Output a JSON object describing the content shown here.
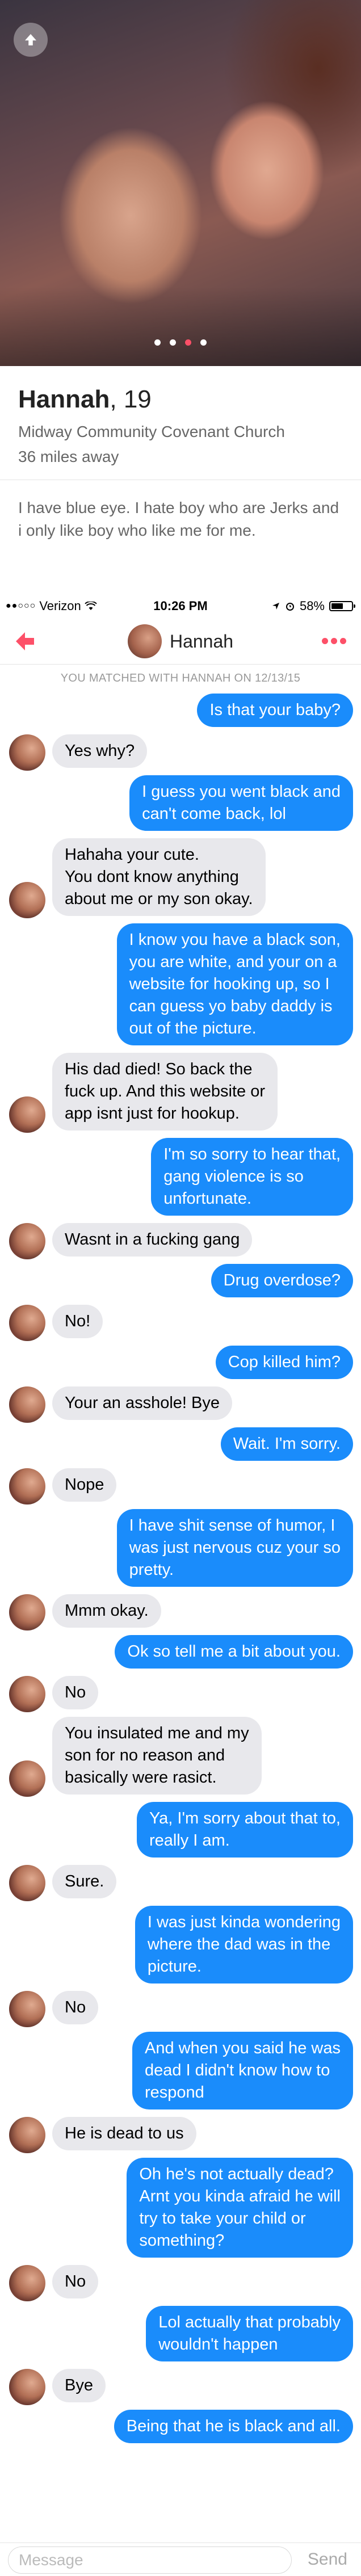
{
  "colors": {
    "accent": "#fd5068",
    "outgoing_bubble": "#1a8cfb",
    "incoming_bubble": "#e8e8ec"
  },
  "profile": {
    "name": "Hannah",
    "age": "19",
    "school": "Midway Community Covenant Church",
    "distance": "36 miles away",
    "bio": "I have blue eye. I hate boy who are Jerks and i only like boy who like me for me.",
    "photo_count": 4,
    "active_photo_index": 3
  },
  "status_bar": {
    "carrier": "Verizon",
    "time": "10:26 PM",
    "battery": "58%",
    "battery_level": 0.58
  },
  "chat": {
    "header_name": "Hannah",
    "match_note": "YOU MATCHED WITH HANNAH ON 12/13/15",
    "composer_placeholder": "Message",
    "send_label": "Send",
    "messages": [
      {
        "from": "me",
        "lines": [
          "Is that your baby?"
        ]
      },
      {
        "from": "her",
        "lines": [
          "Yes why?"
        ]
      },
      {
        "from": "me",
        "lines": [
          "I guess you went black and",
          "can't come back, lol"
        ]
      },
      {
        "from": "her",
        "lines": [
          "Hahaha your cute.",
          "You dont know anything",
          "about me or my son okay."
        ]
      },
      {
        "from": "me",
        "lines": [
          "I know you have a black son,",
          "you are white, and your on a",
          "website for hooking up, so I",
          "can guess yo baby daddy is",
          "out of the picture."
        ]
      },
      {
        "from": "her",
        "lines": [
          "His dad died! So back the",
          "fuck up. And this website or",
          "app isnt just for hookup."
        ]
      },
      {
        "from": "me",
        "lines": [
          "I'm so sorry to hear that,",
          "gang violence is so",
          "unfortunate."
        ]
      },
      {
        "from": "her",
        "lines": [
          "Wasnt in a fucking gang"
        ]
      },
      {
        "from": "me",
        "lines": [
          "Drug overdose?"
        ]
      },
      {
        "from": "her",
        "lines": [
          "No!"
        ]
      },
      {
        "from": "me",
        "lines": [
          "Cop killed him?"
        ]
      },
      {
        "from": "her",
        "lines": [
          "Your an asshole! Bye"
        ]
      },
      {
        "from": "me",
        "lines": [
          "Wait. I'm sorry."
        ]
      },
      {
        "from": "her",
        "lines": [
          "Nope"
        ]
      },
      {
        "from": "me",
        "lines": [
          "I have shit sense of humor, I",
          "was just nervous cuz your so",
          "pretty."
        ]
      },
      {
        "from": "her",
        "lines": [
          "Mmm okay."
        ]
      },
      {
        "from": "me",
        "lines": [
          "Ok so tell me a bit about you."
        ]
      },
      {
        "from": "her",
        "lines": [
          "No"
        ]
      },
      {
        "from": "her",
        "lines": [
          "You insulated me and my",
          "son for no reason and",
          "basically were rasict."
        ]
      },
      {
        "from": "me",
        "lines": [
          "Ya, I'm sorry about that to,",
          "really I am."
        ]
      },
      {
        "from": "her",
        "lines": [
          "Sure."
        ]
      },
      {
        "from": "me",
        "lines": [
          "I was just kinda wondering",
          "where the dad was in the",
          "picture."
        ]
      },
      {
        "from": "her",
        "lines": [
          "No"
        ]
      },
      {
        "from": "me",
        "lines": [
          "And when you said he was",
          "dead I didn't know how to",
          "respond"
        ]
      },
      {
        "from": "her",
        "lines": [
          "He is dead to us"
        ]
      },
      {
        "from": "me",
        "lines": [
          "Oh he's not actually dead?",
          "Arnt you kinda afraid he will",
          "try to take your child or",
          "something?"
        ]
      },
      {
        "from": "her",
        "lines": [
          "No"
        ]
      },
      {
        "from": "me",
        "lines": [
          "Lol actually that probably",
          "wouldn't happen"
        ]
      },
      {
        "from": "her",
        "lines": [
          "Bye"
        ]
      },
      {
        "from": "me",
        "lines": [
          "Being that he is black and all."
        ]
      }
    ]
  }
}
